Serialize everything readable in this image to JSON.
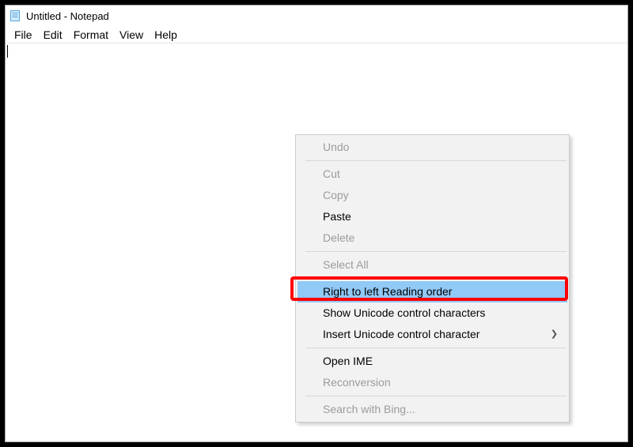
{
  "window": {
    "title": "Untitled - Notepad"
  },
  "menubar": {
    "items": [
      "File",
      "Edit",
      "Format",
      "View",
      "Help"
    ]
  },
  "context_menu": {
    "items": [
      {
        "label": "Undo",
        "disabled": true
      },
      {
        "sep": true
      },
      {
        "label": "Cut",
        "disabled": true
      },
      {
        "label": "Copy",
        "disabled": true
      },
      {
        "label": "Paste",
        "disabled": false
      },
      {
        "label": "Delete",
        "disabled": true
      },
      {
        "sep": true
      },
      {
        "label": "Select All",
        "disabled": true
      },
      {
        "sep": true
      },
      {
        "label": "Right to left Reading order",
        "disabled": false,
        "highlighted": true
      },
      {
        "label": "Show Unicode control characters",
        "disabled": false
      },
      {
        "label": "Insert Unicode control character",
        "disabled": false,
        "submenu": true
      },
      {
        "sep": true
      },
      {
        "label": "Open IME",
        "disabled": false
      },
      {
        "label": "Reconversion",
        "disabled": true
      },
      {
        "sep": true
      },
      {
        "label": "Search with Bing...",
        "disabled": true
      }
    ]
  }
}
